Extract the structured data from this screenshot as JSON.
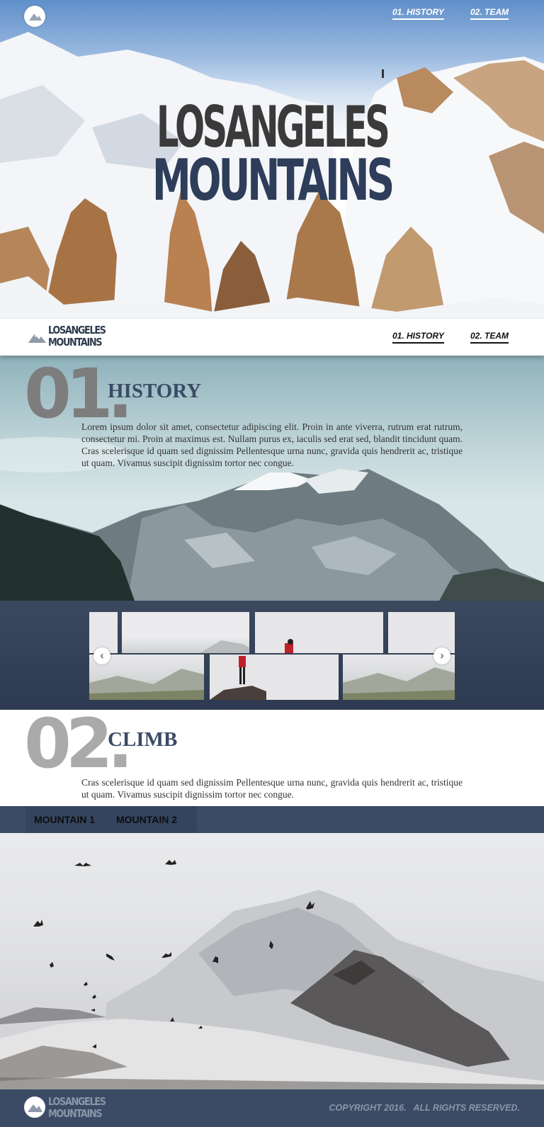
{
  "nav": {
    "history_label": "01. HISTORY",
    "team_label": "02. TEAM"
  },
  "hero": {
    "title_line1": "LOSANGELES",
    "title_line2": "MOUNTAINS"
  },
  "brand": {
    "line1": "LOSANGELES",
    "line2": "MOUNTAINS"
  },
  "history": {
    "number": "01.",
    "title": "HISTORY",
    "text": "Lorem ipsum dolor sit amet, consectetur adipiscing elit. Proin in ante viverra, rutrum erat rutrum, consectetur mi. Proin at maximus est. Nullam purus ex, iaculis sed erat sed, blandit tincidunt quam. Cras scelerisque id quam sed dignissim Pellentesque urna nunc, gravida quis hendrerit ac, tristique ut quam. Vivamus suscipit dignissim tortor nec congue."
  },
  "gallery": {
    "prev_icon": "chevron-left-icon",
    "next_icon": "chevron-right-icon",
    "prev_glyph": "‹",
    "next_glyph": "›"
  },
  "climb": {
    "number": "02.",
    "title": "CLIMB",
    "text": "Cras scelerisque id quam sed dignissim Pellentesque urna nunc, gravida quis hendrerit ac, tristique ut quam. Vivamus suscipit dignissim tortor nec congue.",
    "tabs": [
      "MOUNTAIN 1",
      "MOUNTAIN 2"
    ]
  },
  "footer": {
    "copyright": "COPYRIGHT 2016.   ALL RIGHTS RESERVED."
  },
  "colors": {
    "navy": "#3b4b66",
    "hero_title_top": "#3a3a3a",
    "hero_title_bottom": "#2e3d5a",
    "number_grey": "#7d7d7d"
  }
}
